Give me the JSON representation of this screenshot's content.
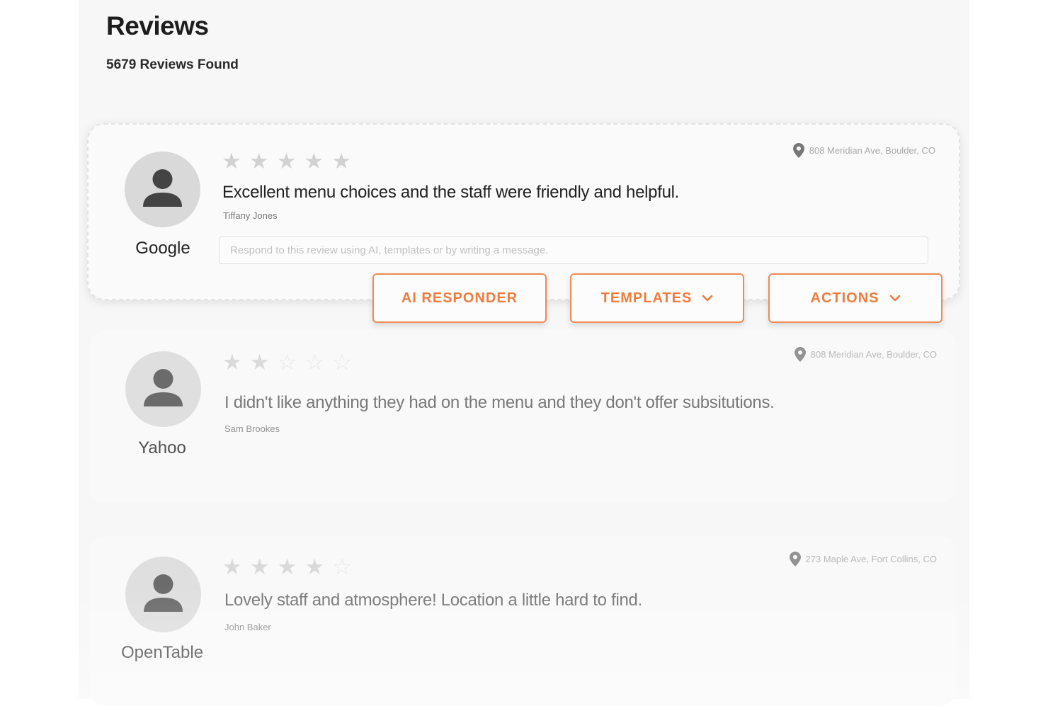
{
  "page": {
    "title": "Reviews",
    "count_label": "5679 Reviews Found"
  },
  "reply": {
    "placeholder": "Respond to this review using AI, templates or by writing a message."
  },
  "actions": {
    "ai_responder": "AI RESPONDER",
    "templates": "TEMPLATES",
    "actions": "ACTIONS",
    "accent_color": "#ee7c3e"
  },
  "reviews": [
    {
      "source": "Google",
      "rating": 5,
      "location": "808 Meridian Ave, Boulder, CO",
      "text": "Excellent menu choices and the staff were friendly and helpful.",
      "author": "Tiffany Jones",
      "avatar_icon": "person-icon",
      "location_icon": "map-pin-icon"
    },
    {
      "source": "Yahoo",
      "rating": 2,
      "location": "808 Meridian Ave, Boulder, CO",
      "text": "I didn't like anything they had on the menu and they don't offer subsitutions.",
      "author": "Sam Brookes",
      "avatar_icon": "person-icon",
      "location_icon": "map-pin-icon"
    },
    {
      "source": "OpenTable",
      "rating": 4,
      "location": "273 Maple Ave, Fort Collins, CO",
      "text": "Lovely staff and atmosphere! Location a little hard to find.",
      "author": "John Baker",
      "avatar_icon": "person-icon",
      "location_icon": "map-pin-icon"
    }
  ]
}
